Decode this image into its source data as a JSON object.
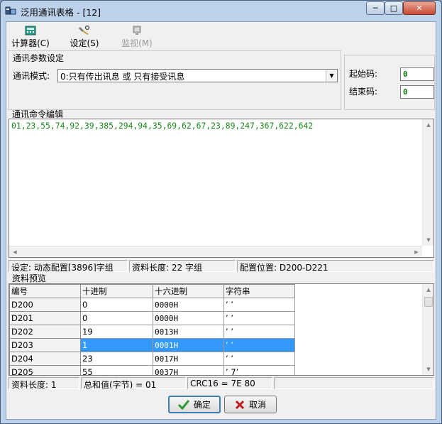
{
  "window": {
    "title": "泛用通讯表格 - [12]",
    "caption_min": "─",
    "caption_max": "□",
    "caption_close": "✕"
  },
  "toolbar": {
    "calculator": "计算器(C)",
    "settings": "设定(S)",
    "monitor": "监视(M)"
  },
  "comm_params": {
    "group_title": "通讯参数设定",
    "mode_label": "通讯模式:",
    "mode_value": "0:只有传出讯息 或 只有接受讯息",
    "start_code_label": "起始码:",
    "start_code_value": "0",
    "end_code_label": "结束码:",
    "end_code_value": "0"
  },
  "command_editor": {
    "group_title": "通讯命令编辑",
    "text": "01,23,55,74,92,39,385,294,94,35,69,62,67,23,89,247,367,622,642"
  },
  "status1": {
    "config": "设定: 动态配置[3896]字组",
    "length": "资料长度: 22 字组",
    "location": "配置位置: D200-D221"
  },
  "preview": {
    "group_title": "资料预览",
    "columns": [
      "编号",
      "十进制",
      "十六进制",
      "字符串"
    ],
    "rows": [
      {
        "id": "D200",
        "dec": "0",
        "hex": "0000H",
        "str": "’ ’"
      },
      {
        "id": "D201",
        "dec": "0",
        "hex": "0000H",
        "str": "’ ’"
      },
      {
        "id": "D202",
        "dec": "19",
        "hex": "0013H",
        "str": "’ ’"
      },
      {
        "id": "D203",
        "dec": "1",
        "hex": "0001H",
        "str": "’ ’"
      },
      {
        "id": "D204",
        "dec": "23",
        "hex": "0017H",
        "str": "’ ’"
      },
      {
        "id": "D205",
        "dec": "55",
        "hex": "0037H",
        "str": "’ 7’"
      }
    ],
    "selected_row": 3
  },
  "status2": {
    "length": "资料长度: 1",
    "checksum": "总和值(字节) = 01",
    "crc": "CRC16 = 7E 80"
  },
  "buttons": {
    "ok": "确定",
    "cancel": "取消"
  },
  "colors": {
    "accent": "#3399ff",
    "code_text": "#1a8a1a",
    "ok_icon": "#2e9a2e",
    "cancel_icon": "#c0181c"
  },
  "icons": {
    "app": "app-plc-icon",
    "calculator": "calculator-icon",
    "settings": "wrench-icon",
    "monitor": "monitor-icon",
    "ok": "checkmark-icon",
    "cancel": "x-icon"
  }
}
